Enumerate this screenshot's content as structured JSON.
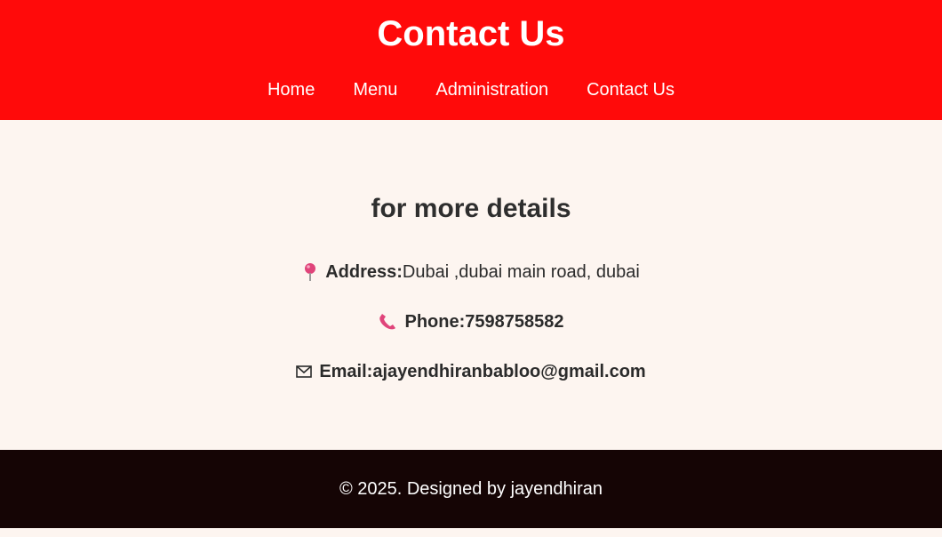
{
  "header": {
    "title": "Contact Us",
    "nav": [
      {
        "label": "Home"
      },
      {
        "label": "Menu"
      },
      {
        "label": "Administration"
      },
      {
        "label": "Contact Us"
      }
    ]
  },
  "main": {
    "heading": "for more details",
    "address": {
      "icon": "pin-icon",
      "label": "Address:",
      "value": "Dubai ,dubai main road, dubai"
    },
    "phone": {
      "icon": "phone-icon",
      "label": "Phone:",
      "value": "7598758582"
    },
    "email": {
      "icon": "envelope-icon",
      "label": "Email:",
      "value": "ajayendhiranbabloo@gmail.com"
    }
  },
  "footer": {
    "text": "© 2025. Designed by jayendhiran"
  },
  "colors": {
    "header_bg": "#ff0a0a",
    "body_bg": "#fdf5f0",
    "footer_bg": "#150505",
    "icon_pink": "#e0447a"
  }
}
